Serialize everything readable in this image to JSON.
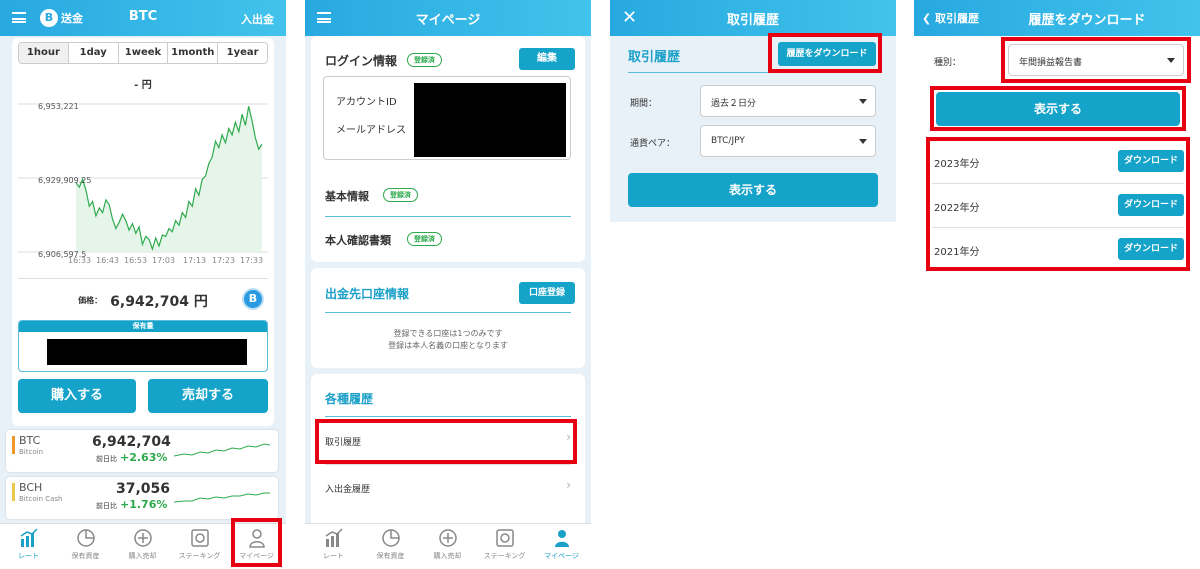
{
  "tabbar": {
    "items": [
      "レート",
      "保有資産",
      "購入売却",
      "ステーキング",
      "マイページ"
    ]
  },
  "screen1": {
    "send_label": "送金",
    "coin_symbol": "B",
    "title": "BTC",
    "deposit_label": "入出金",
    "periods": [
      "1hour",
      "1day",
      "1week",
      "1month",
      "1year"
    ],
    "selected_period": "1hour",
    "price_unit_line": "- 円",
    "price_label": "価格：",
    "price_value": "6,942,704 円",
    "holding_label": "保有量",
    "buy_label": "購入する",
    "sell_label": "売却する",
    "coins": [
      {
        "symbol": "BTC",
        "name": "Bitcoin",
        "price": "6,942,704",
        "change_label": "前日比",
        "change": "+2.63%",
        "color": "#f0962a"
      },
      {
        "symbol": "BCH",
        "name": "Bitcoin Cash",
        "price": "37,056",
        "change_label": "前日比",
        "change": "+1.76%",
        "color": "#e8c84a"
      }
    ]
  },
  "chart_data": {
    "type": "area",
    "x_ticks": [
      "16:33",
      "16:43",
      "16:53",
      "17:03",
      "17:13",
      "17:23",
      "17:33"
    ],
    "y_ticks": [
      "6,953,221",
      "6,929,909.25",
      "6,906,597.5"
    ],
    "ylim": [
      6906597.5,
      6953221
    ],
    "series": [
      {
        "values": [
          6928500,
          6927000,
          6929500,
          6926000,
          6921000,
          6922500,
          6918000,
          6920500,
          6919000,
          6923000,
          6921500,
          6917000,
          6914000,
          6916000,
          6918500,
          6916500,
          6913500,
          6915500,
          6912500,
          6914500,
          6909000,
          6911500,
          6910500,
          6907500,
          6911000,
          6908500,
          6912000,
          6911500,
          6914000,
          6913000,
          6916500,
          6915000,
          6919000,
          6917500,
          6922500,
          6921000,
          6926500,
          6924500,
          6929500,
          6930500,
          6934500,
          6936500,
          6941500,
          6939500,
          6943500,
          6941000,
          6945500,
          6943500,
          6947500,
          6944500,
          6950000,
          6946500,
          6952500,
          6948000,
          6942500,
          6939000,
          6940500
        ]
      }
    ],
    "grid": true
  },
  "screen2": {
    "title": "マイページ",
    "login_title": "ログイン情報",
    "registered": "登録済",
    "edit_label": "編集",
    "account_id_label": "アカウントID",
    "email_label": "メールアドレス",
    "basic_info": "基本情報",
    "identity_docs": "本人確認書類",
    "withdraw_title": "出金先口座情報",
    "account_register": "口座登録",
    "note1": "登録できる口座は1つのみです",
    "note2": "登録は本人名義の口座となります",
    "history_title": "各種履歴",
    "trade_history": "取引履歴",
    "deposit_history": "入出金履歴"
  },
  "screen3": {
    "title": "取引履歴",
    "section_title": "取引履歴",
    "download_label": "履歴をダウンロード",
    "period_label": "期間：",
    "period_value": "過去２日分",
    "pair_label": "通貨ペア：",
    "pair_value": "BTC/JPY",
    "show_label": "表示する"
  },
  "screen4": {
    "back_label": "取引履歴",
    "title": "履歴をダウンロード",
    "type_label": "種別：",
    "type_value": "年間損益報告書",
    "show_label": "表示する",
    "years": [
      {
        "label": "2023年分",
        "button": "ダウンロード"
      },
      {
        "label": "2022年分",
        "button": "ダウンロード"
      },
      {
        "label": "2021年分",
        "button": "ダウンロード"
      }
    ]
  }
}
